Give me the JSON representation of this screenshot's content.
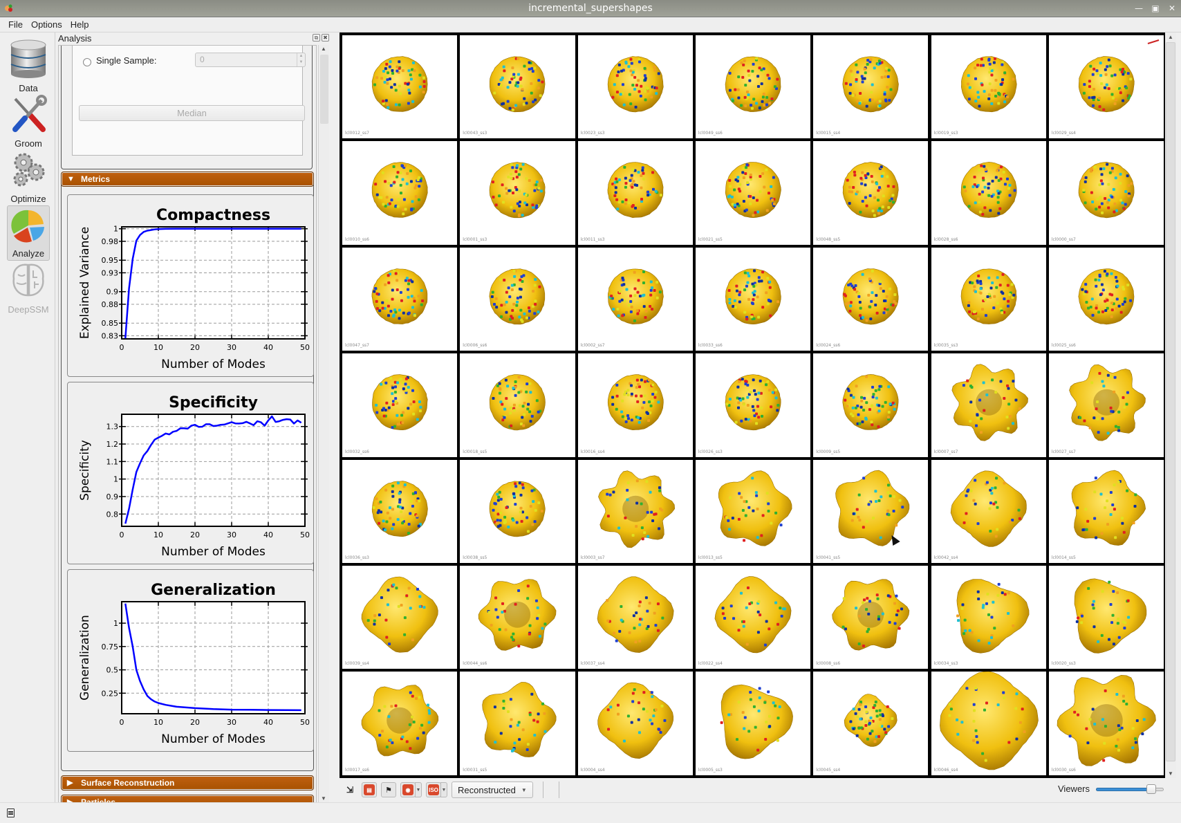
{
  "window": {
    "title": "incremental_supershapes"
  },
  "menu": [
    "File",
    "Options",
    "Help"
  ],
  "toolbar": [
    {
      "label": "Data",
      "icon": "database-icon",
      "active": false,
      "disabled": false
    },
    {
      "label": "Groom",
      "icon": "tools-icon",
      "active": false,
      "disabled": false
    },
    {
      "label": "Optimize",
      "icon": "gears-icon",
      "active": false,
      "disabled": false
    },
    {
      "label": "Analyze",
      "icon": "pie-chart-icon",
      "active": true,
      "disabled": false
    },
    {
      "label": "DeepSSM",
      "icon": "brain-icon",
      "active": false,
      "disabled": true
    }
  ],
  "analysis": {
    "title": "Analysis",
    "single_sample_label": "Single Sample:",
    "single_sample_value": "0",
    "median_label": "Median",
    "sections": {
      "metrics": "Metrics",
      "surface_reconstruction": "Surface Reconstruction",
      "particles": "Particles"
    }
  },
  "chart_data": [
    {
      "type": "line",
      "title": "Compactness",
      "xlabel": "Number of Modes",
      "ylabel": "Explained Variance",
      "xlim": [
        0,
        50
      ],
      "ylim": [
        0.825,
        1.003
      ],
      "xticks": [
        0,
        10,
        20,
        30,
        40,
        50
      ],
      "yticks": [
        0.83,
        0.85,
        0.88,
        0.9,
        0.93,
        0.95,
        0.98,
        1
      ],
      "ytick_labels": [
        "0.83",
        "0.85",
        "0.88",
        "0.9",
        "0.93",
        "0.95",
        "0.98",
        "1"
      ],
      "grid": true,
      "color": "#0000ff",
      "x": [
        1,
        2,
        3,
        4,
        5,
        6,
        7,
        8,
        9,
        10,
        12,
        15,
        20,
        30,
        40,
        49
      ],
      "y": [
        0.826,
        0.905,
        0.952,
        0.981,
        0.99,
        0.995,
        0.997,
        0.998,
        0.999,
        0.9995,
        0.9998,
        0.9999,
        1,
        1,
        1,
        1
      ]
    },
    {
      "type": "line",
      "title": "Specificity",
      "xlabel": "Number of Modes",
      "ylabel": "Specificity",
      "xlim": [
        0,
        50
      ],
      "ylim": [
        0.73,
        1.37
      ],
      "xticks": [
        0,
        10,
        20,
        30,
        40,
        50
      ],
      "yticks": [
        0.8,
        0.9,
        1,
        1.1,
        1.2,
        1.3
      ],
      "ytick_labels": [
        "0.8",
        "0.9",
        "1",
        "1.1",
        "1.2",
        "1.3"
      ],
      "grid": true,
      "color": "#0000ff",
      "x": [
        1,
        2,
        3,
        4,
        5,
        6,
        7,
        8,
        9,
        10,
        11,
        12,
        13,
        14,
        15,
        16,
        17,
        18,
        19,
        20,
        21,
        22,
        23,
        24,
        25,
        26,
        27,
        28,
        29,
        30,
        31,
        32,
        33,
        34,
        35,
        36,
        37,
        38,
        39,
        40,
        41,
        42,
        43,
        44,
        45,
        46,
        47,
        48,
        49
      ],
      "y": [
        0.745,
        0.83,
        0.94,
        1.04,
        1.09,
        1.135,
        1.16,
        1.195,
        1.225,
        1.237,
        1.247,
        1.26,
        1.255,
        1.27,
        1.275,
        1.29,
        1.29,
        1.288,
        1.305,
        1.31,
        1.298,
        1.299,
        1.313,
        1.313,
        1.303,
        1.305,
        1.31,
        1.311,
        1.318,
        1.325,
        1.318,
        1.317,
        1.319,
        1.327,
        1.318,
        1.308,
        1.33,
        1.324,
        1.305,
        1.335,
        1.358,
        1.326,
        1.33,
        1.338,
        1.342,
        1.34,
        1.317,
        1.335,
        1.322
      ]
    },
    {
      "type": "line",
      "title": "Generalization",
      "xlabel": "Number of Modes",
      "ylabel": "Generalization",
      "xlim": [
        0,
        50
      ],
      "ylim": [
        0.03,
        1.23
      ],
      "xticks": [
        0,
        10,
        20,
        30,
        40,
        50
      ],
      "yticks": [
        0.25,
        0.5,
        0.75,
        1
      ],
      "ytick_labels": [
        "0.25",
        "0.5",
        "0.75",
        "1"
      ],
      "grid": true,
      "color": "#0000ff",
      "x": [
        1,
        2,
        3,
        4,
        5,
        6,
        7,
        8,
        9,
        10,
        12,
        15,
        20,
        25,
        30,
        35,
        40,
        45,
        49
      ],
      "y": [
        1.21,
        0.95,
        0.75,
        0.5,
        0.38,
        0.29,
        0.22,
        0.185,
        0.16,
        0.145,
        0.125,
        0.105,
        0.09,
        0.08,
        0.074,
        0.072,
        0.07,
        0.069,
        0.068
      ]
    }
  ],
  "shapes": [
    {
      "name": "lcl0012_ss7",
      "kind": "sphere"
    },
    {
      "name": "lcl0043_ss3",
      "kind": "sphere"
    },
    {
      "name": "lcl0023_ss3",
      "kind": "sphere"
    },
    {
      "name": "lcl0049_ss6",
      "kind": "sphere"
    },
    {
      "name": "lcl0015_ss4",
      "kind": "sphere"
    },
    {
      "name": "lcl0019_ss3",
      "kind": "sphere"
    },
    {
      "name": "lcl0029_ss4",
      "kind": "sphere"
    },
    {
      "name": "lcl0010_ss6",
      "kind": "sphere"
    },
    {
      "name": "lcl0001_ss3",
      "kind": "sphere"
    },
    {
      "name": "lcl0011_ss3",
      "kind": "sphere"
    },
    {
      "name": "lcl0021_ss5",
      "kind": "sphere"
    },
    {
      "name": "lcl0048_ss5",
      "kind": "sphere"
    },
    {
      "name": "lcl0028_ss6",
      "kind": "sphere"
    },
    {
      "name": "lcl0000_ss7",
      "kind": "sphere"
    },
    {
      "name": "lcl0047_ss7",
      "kind": "sphere"
    },
    {
      "name": "lcl0006_ss6",
      "kind": "sphere"
    },
    {
      "name": "lcl0002_ss7",
      "kind": "sphere"
    },
    {
      "name": "lcl0033_ss6",
      "kind": "sphere"
    },
    {
      "name": "lcl0024_ss6",
      "kind": "sphere"
    },
    {
      "name": "lcl0035_ss3",
      "kind": "sphere"
    },
    {
      "name": "lcl0025_ss6",
      "kind": "sphere"
    },
    {
      "name": "lcl0032_ss6",
      "kind": "sphere"
    },
    {
      "name": "lcl0018_ss5",
      "kind": "sphere"
    },
    {
      "name": "lcl0016_ss4",
      "kind": "sphere"
    },
    {
      "name": "lcl0026_ss3",
      "kind": "sphere"
    },
    {
      "name": "lcl0009_ss5",
      "kind": "sphere"
    },
    {
      "name": "lcl0007_ss7",
      "kind": "star7"
    },
    {
      "name": "lcl0027_ss7",
      "kind": "star7"
    },
    {
      "name": "lcl0036_ss3",
      "kind": "sphere"
    },
    {
      "name": "lcl0038_ss5",
      "kind": "sphere"
    },
    {
      "name": "lcl0003_ss7",
      "kind": "star7"
    },
    {
      "name": "lcl0013_ss5",
      "kind": "star5"
    },
    {
      "name": "lcl0041_ss5",
      "kind": "star5"
    },
    {
      "name": "lcl0042_ss4",
      "kind": "square"
    },
    {
      "name": "lcl0014_ss5",
      "kind": "star5"
    },
    {
      "name": "lcl0039_ss4",
      "kind": "square"
    },
    {
      "name": "lcl0044_ss6",
      "kind": "star6"
    },
    {
      "name": "lcl0037_ss4",
      "kind": "square"
    },
    {
      "name": "lcl0022_ss4",
      "kind": "square"
    },
    {
      "name": "lcl0008_ss6",
      "kind": "star6"
    },
    {
      "name": "lcl0034_ss3",
      "kind": "tri"
    },
    {
      "name": "lcl0020_ss3",
      "kind": "tri"
    },
    {
      "name": "lcl0017_ss6",
      "kind": "star6"
    },
    {
      "name": "lcl0031_ss5",
      "kind": "star5"
    },
    {
      "name": "lcl0004_ss4",
      "kind": "square"
    },
    {
      "name": "lcl0005_ss3",
      "kind": "tri"
    },
    {
      "name": "lcl0045_ss4",
      "kind": "small"
    },
    {
      "name": "lcl0046_ss4",
      "kind": "bigsquare"
    },
    {
      "name": "lcl0030_ss6",
      "kind": "bigstar6"
    }
  ],
  "bottom_toolbar": {
    "display_mode": "Reconstructed",
    "viewers_label": "Viewers",
    "viewers_slider_fraction": 0.82
  }
}
